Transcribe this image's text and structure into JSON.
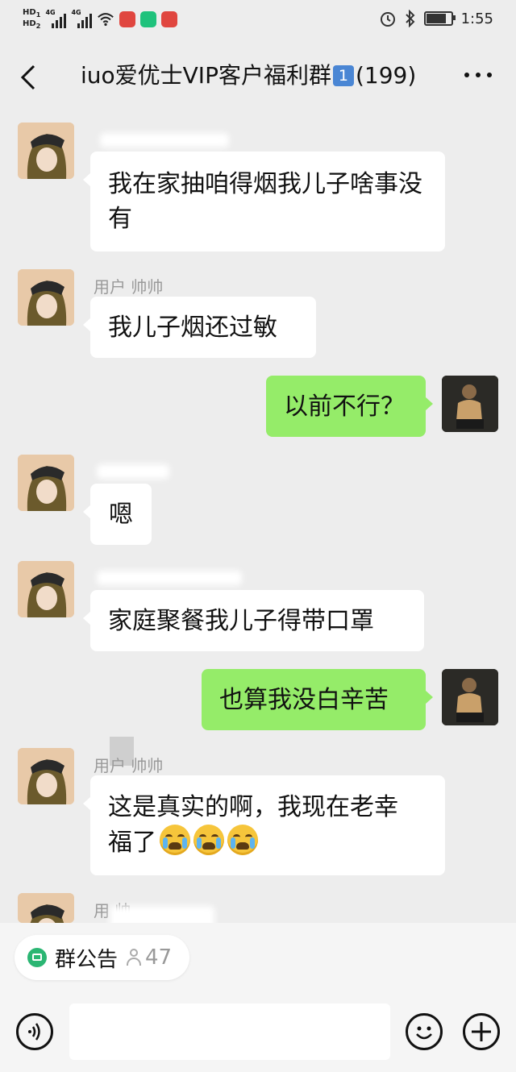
{
  "status_bar": {
    "hd1": "HD",
    "hd1_sub": "1",
    "hd2": "HD",
    "hd2_sub": "2",
    "network1": "4G",
    "network2": "4G",
    "time": "1:55"
  },
  "header": {
    "title_prefix": "iuo爱优士VIP客户福利群",
    "title_badge": "1",
    "title_count": "(199)"
  },
  "messages": [
    {
      "side": "in",
      "sender": "",
      "text": "我在家抽咱得烟我儿子啥事没有"
    },
    {
      "side": "in",
      "sender": "用户 帅帅",
      "text": "我儿子烟还过敏"
    },
    {
      "side": "out",
      "text": "以前不行？"
    },
    {
      "side": "in",
      "sender": "",
      "text": "嗯"
    },
    {
      "side": "in",
      "sender": "",
      "text": "家庭聚餐我儿子得带口罩"
    },
    {
      "side": "out",
      "text": "也算我没白辛苦"
    },
    {
      "side": "in",
      "sender": "用户 帅帅",
      "text_line1": "这是真实的啊，我现在老幸",
      "text_line2": "福了",
      "emoji": [
        "loudly-crying-face",
        "loudly-crying-face",
        "loudly-crying-face"
      ]
    },
    {
      "side": "in",
      "sender": "用 帅"
    }
  ],
  "notice": {
    "label": "群公告",
    "count": "47"
  },
  "input_bar": {
    "voice_icon": "voice-icon",
    "emoji_icon": "emoji-icon",
    "plus_icon": "plus-icon"
  },
  "colors": {
    "background": "#ededed",
    "self_bubble": "#95ec69",
    "other_bubble": "#ffffff",
    "notice_icon": "#2bb673"
  }
}
